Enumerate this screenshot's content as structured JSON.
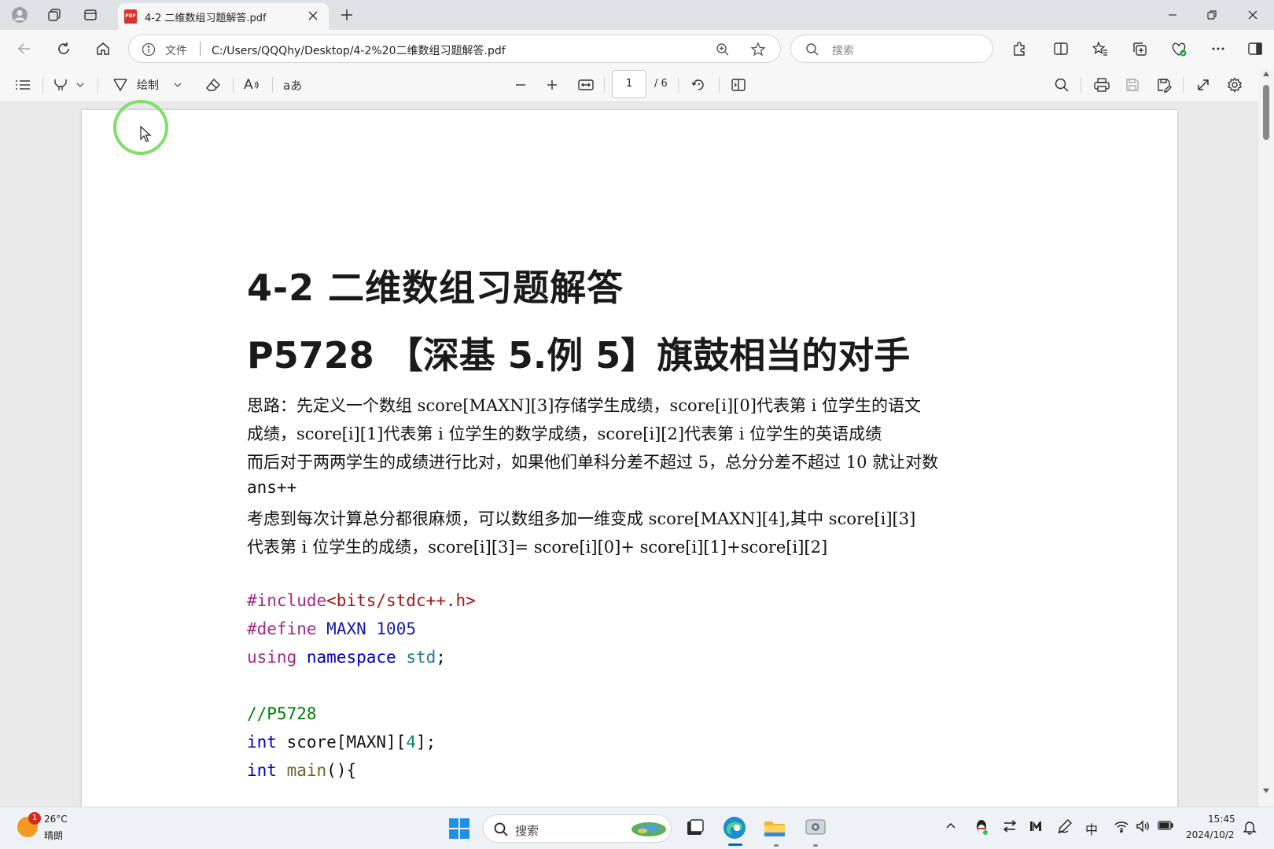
{
  "browser": {
    "tab": {
      "title": "4-2 二维数组习题解答.pdf",
      "pdf_badge": "PDF"
    },
    "address": {
      "prefix": "文件",
      "url": "C:/Users/QQQhy/Desktop/4-2%20二维数组习题解答.pdf"
    },
    "search": {
      "placeholder": "搜索"
    }
  },
  "pdf_toolbar": {
    "draw_label": "绘制",
    "read_aloud_label": "A",
    "translate_label": "aあ",
    "current_page": "1",
    "total_pages": "/ 6"
  },
  "document": {
    "heading1": "4-2  二维数组习题解答",
    "heading2": "P5728  【深基 5.例 5】旗鼓相当的对手",
    "paragraphs": [
      "思路：先定义一个数组 score[MAXN][3]存储学生成绩，score[i][0]代表第 i 位学生的语文",
      "成绩，score[i][1]代表第 i 位学生的数学成绩，score[i][2]代表第 i 位学生的英语成绩",
      "而后对于两两学生的成绩进行比对，如果他们单科分差不超过 5，总分分差不超过 10 就让对数",
      "ans++",
      "考虑到每次计算总分都很麻烦，可以数组多加一维变成 score[MAXN][4],其中 score[i][3]",
      "代表第 i 位学生的成绩，score[i][3]= score[i][0]+ score[i][1]+score[i][2]"
    ],
    "code": {
      "include_kw": "#include",
      "include_file": "<bits/stdc++.h>",
      "define_kw": "#define",
      "define_name": "MAXN",
      "define_val": "1005",
      "using_kw": "using",
      "namespace_kw": "namespace",
      "std": "std",
      "semicolon": ";",
      "comment": "//P5728",
      "int1": "int",
      "score_decl": "score[MAXN][",
      "four": "4",
      "decl_end": "];",
      "int2": "int",
      "main_fn": "main",
      "main_rest": "(){"
    }
  },
  "taskbar": {
    "weather_temp": "26°C",
    "weather_desc": "晴朗",
    "weather_badge": "1",
    "search_label": "搜索",
    "ime": "中",
    "time": "15:45",
    "date": "2024/10/2"
  },
  "colors": {
    "accent": "#0067c0",
    "cursor_ring": "#7ee06a",
    "pdf_red": "#d9322b"
  }
}
